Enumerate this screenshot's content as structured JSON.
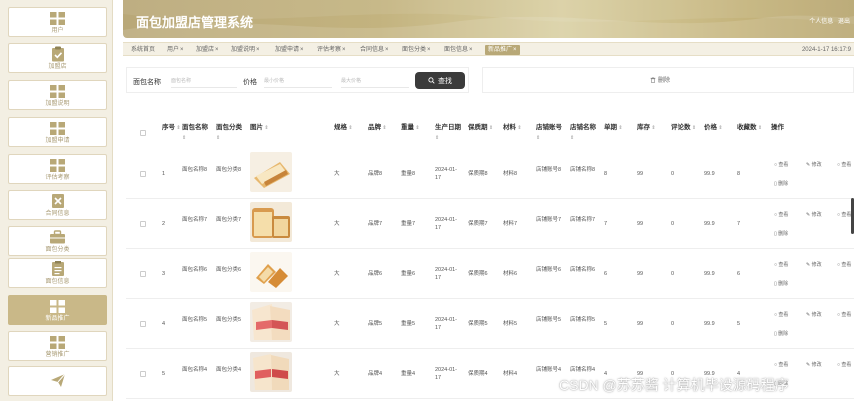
{
  "sidebar": {
    "items": [
      {
        "label": "用户",
        "icon": "grid-icon"
      },
      {
        "label": "加盟店",
        "icon": "clipboard-check-icon"
      },
      {
        "label": "加盟说明",
        "icon": "grid-icon"
      },
      {
        "label": "加盟申请",
        "icon": "grid-icon"
      },
      {
        "label": "评估考察",
        "icon": "grid-icon"
      },
      {
        "label": "合同信息",
        "icon": "close-box-icon"
      },
      {
        "label": "面包分类",
        "icon": "briefcase-icon"
      },
      {
        "label": "面包信息",
        "icon": "document-icon"
      },
      {
        "label": "新品推广",
        "icon": "grid-icon"
      },
      {
        "label": "营销推广",
        "icon": "grid-icon"
      },
      {
        "label": "",
        "icon": "send-icon"
      }
    ],
    "active_index": 8,
    "accent": "#c9b888"
  },
  "header": {
    "title": "面包加盟店管理系统",
    "profile_link": "个人信息",
    "logout_link": "退出"
  },
  "tabs": [
    {
      "label": "系统首页",
      "closable": false
    },
    {
      "label": "用户",
      "closable": true
    },
    {
      "label": "加盟店",
      "closable": true
    },
    {
      "label": "加盟说明",
      "closable": true
    },
    {
      "label": "加盟申请",
      "closable": true
    },
    {
      "label": "评估考察",
      "closable": true
    },
    {
      "label": "合同信息",
      "closable": true
    },
    {
      "label": "面包分类",
      "closable": true
    },
    {
      "label": "面包信息",
      "closable": true
    },
    {
      "label": "新品推广",
      "closable": true,
      "active": true
    }
  ],
  "clock": "2024-1-17 16:17:9",
  "search": {
    "name_label": "面包名称",
    "name_placeholder": "面包名称",
    "price_label": "价格",
    "min_placeholder": "最小价格",
    "max_placeholder": "最大价格",
    "button_label": "查找"
  },
  "actions": {
    "delete_label": "删除"
  },
  "table": {
    "columns": [
      "序号",
      "面包名称",
      "面包分类",
      "图片",
      "规格",
      "品牌",
      "重量",
      "生产日期",
      "保质期",
      "材料",
      "店铺账号",
      "店铺名称",
      "单期",
      "库存",
      "评论数",
      "价格",
      "收藏数",
      "操作"
    ],
    "rows": [
      {
        "idx": "1",
        "name": "面包名称8",
        "category": "面包分类8",
        "spec": "大",
        "brand": "品牌8",
        "weight": "重量8",
        "date": "2024-01-17",
        "shelf": "保质期8",
        "material": "材料8",
        "account": "店铺账号8",
        "shop": "店铺名称8",
        "period": "8",
        "stock": "99",
        "comments": "0",
        "price": "99.9",
        "favs": "8"
      },
      {
        "idx": "2",
        "name": "面包名称7",
        "category": "面包分类7",
        "spec": "大",
        "brand": "品牌7",
        "weight": "重量7",
        "date": "2024-01-17",
        "shelf": "保质期7",
        "material": "材料7",
        "account": "店铺账号7",
        "shop": "店铺名称7",
        "period": "7",
        "stock": "99",
        "comments": "0",
        "price": "99.9",
        "favs": "7"
      },
      {
        "idx": "3",
        "name": "面包名称6",
        "category": "面包分类6",
        "spec": "大",
        "brand": "品牌6",
        "weight": "重量6",
        "date": "2024-01-17",
        "shelf": "保质期6",
        "material": "材料6",
        "account": "店铺账号6",
        "shop": "店铺名称6",
        "period": "6",
        "stock": "99",
        "comments": "0",
        "price": "99.9",
        "favs": "6"
      },
      {
        "idx": "4",
        "name": "面包名称5",
        "category": "面包分类5",
        "spec": "大",
        "brand": "品牌5",
        "weight": "重量5",
        "date": "2024-01-17",
        "shelf": "保质期5",
        "material": "材料5",
        "account": "店铺账号5",
        "shop": "店铺名称5",
        "period": "5",
        "stock": "99",
        "comments": "0",
        "price": "99.9",
        "favs": "5"
      },
      {
        "idx": "5",
        "name": "面包名称4",
        "category": "面包分类4",
        "spec": "大",
        "brand": "品牌4",
        "weight": "重量4",
        "date": "2024-01-17",
        "shelf": "保质期4",
        "material": "材料4",
        "account": "店铺账号4",
        "shop": "店铺名称4",
        "period": "4",
        "stock": "99",
        "comments": "0",
        "price": "99.9",
        "favs": "4"
      }
    ],
    "op_view": "查看",
    "op_edit": "修改",
    "op_delete": "删除"
  },
  "watermark": "CSDN @苏苏酱 计算机毕设源码程序"
}
